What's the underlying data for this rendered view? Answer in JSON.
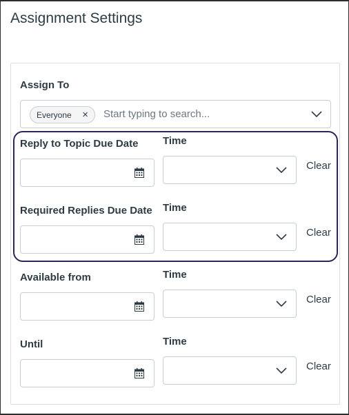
{
  "section_title": "Assignment Settings",
  "assign_to": {
    "label": "Assign To",
    "pill_label": "Everyone",
    "placeholder": "Start typing to search..."
  },
  "rows": [
    {
      "date_label": "Reply to Topic Due Date",
      "time_label": "Time",
      "clear_label": "Clear"
    },
    {
      "date_label": "Required Replies Due Date",
      "time_label": "Time",
      "clear_label": "Clear"
    },
    {
      "date_label": "Available from",
      "time_label": "Time",
      "clear_label": "Clear"
    },
    {
      "date_label": "Until",
      "time_label": "Time",
      "clear_label": "Clear"
    }
  ],
  "icons": {
    "remove": "close-icon",
    "dropdown": "chevron-down-icon",
    "calendar": "calendar-icon"
  },
  "colors": {
    "highlight_border": "#2b2657",
    "text": "#2d3b45",
    "input_border": "#c7cdd1"
  }
}
